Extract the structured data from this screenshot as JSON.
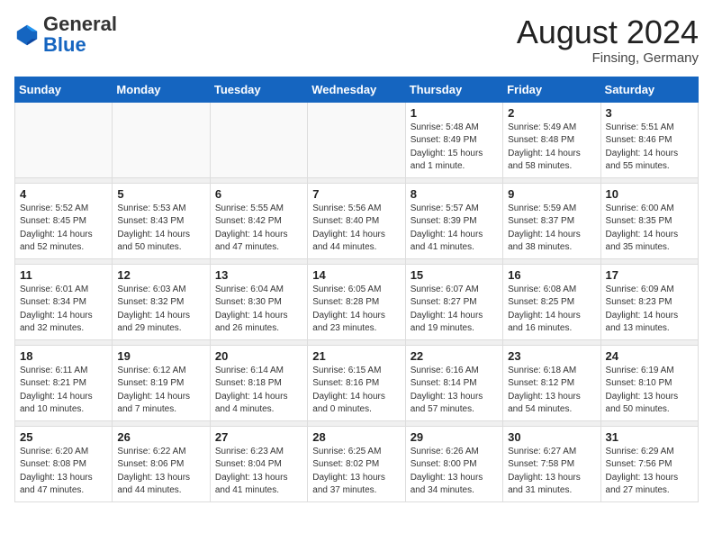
{
  "header": {
    "logo": {
      "general": "General",
      "blue": "Blue"
    },
    "title": "August 2024",
    "location": "Finsing, Germany"
  },
  "calendar": {
    "days_of_week": [
      "Sunday",
      "Monday",
      "Tuesday",
      "Wednesday",
      "Thursday",
      "Friday",
      "Saturday"
    ],
    "weeks": [
      [
        {
          "num": "",
          "detail": ""
        },
        {
          "num": "",
          "detail": ""
        },
        {
          "num": "",
          "detail": ""
        },
        {
          "num": "",
          "detail": ""
        },
        {
          "num": "1",
          "detail": "Sunrise: 5:48 AM\nSunset: 8:49 PM\nDaylight: 15 hours\nand 1 minute."
        },
        {
          "num": "2",
          "detail": "Sunrise: 5:49 AM\nSunset: 8:48 PM\nDaylight: 14 hours\nand 58 minutes."
        },
        {
          "num": "3",
          "detail": "Sunrise: 5:51 AM\nSunset: 8:46 PM\nDaylight: 14 hours\nand 55 minutes."
        }
      ],
      [
        {
          "num": "4",
          "detail": "Sunrise: 5:52 AM\nSunset: 8:45 PM\nDaylight: 14 hours\nand 52 minutes."
        },
        {
          "num": "5",
          "detail": "Sunrise: 5:53 AM\nSunset: 8:43 PM\nDaylight: 14 hours\nand 50 minutes."
        },
        {
          "num": "6",
          "detail": "Sunrise: 5:55 AM\nSunset: 8:42 PM\nDaylight: 14 hours\nand 47 minutes."
        },
        {
          "num": "7",
          "detail": "Sunrise: 5:56 AM\nSunset: 8:40 PM\nDaylight: 14 hours\nand 44 minutes."
        },
        {
          "num": "8",
          "detail": "Sunrise: 5:57 AM\nSunset: 8:39 PM\nDaylight: 14 hours\nand 41 minutes."
        },
        {
          "num": "9",
          "detail": "Sunrise: 5:59 AM\nSunset: 8:37 PM\nDaylight: 14 hours\nand 38 minutes."
        },
        {
          "num": "10",
          "detail": "Sunrise: 6:00 AM\nSunset: 8:35 PM\nDaylight: 14 hours\nand 35 minutes."
        }
      ],
      [
        {
          "num": "11",
          "detail": "Sunrise: 6:01 AM\nSunset: 8:34 PM\nDaylight: 14 hours\nand 32 minutes."
        },
        {
          "num": "12",
          "detail": "Sunrise: 6:03 AM\nSunset: 8:32 PM\nDaylight: 14 hours\nand 29 minutes."
        },
        {
          "num": "13",
          "detail": "Sunrise: 6:04 AM\nSunset: 8:30 PM\nDaylight: 14 hours\nand 26 minutes."
        },
        {
          "num": "14",
          "detail": "Sunrise: 6:05 AM\nSunset: 8:28 PM\nDaylight: 14 hours\nand 23 minutes."
        },
        {
          "num": "15",
          "detail": "Sunrise: 6:07 AM\nSunset: 8:27 PM\nDaylight: 14 hours\nand 19 minutes."
        },
        {
          "num": "16",
          "detail": "Sunrise: 6:08 AM\nSunset: 8:25 PM\nDaylight: 14 hours\nand 16 minutes."
        },
        {
          "num": "17",
          "detail": "Sunrise: 6:09 AM\nSunset: 8:23 PM\nDaylight: 14 hours\nand 13 minutes."
        }
      ],
      [
        {
          "num": "18",
          "detail": "Sunrise: 6:11 AM\nSunset: 8:21 PM\nDaylight: 14 hours\nand 10 minutes."
        },
        {
          "num": "19",
          "detail": "Sunrise: 6:12 AM\nSunset: 8:19 PM\nDaylight: 14 hours\nand 7 minutes."
        },
        {
          "num": "20",
          "detail": "Sunrise: 6:14 AM\nSunset: 8:18 PM\nDaylight: 14 hours\nand 4 minutes."
        },
        {
          "num": "21",
          "detail": "Sunrise: 6:15 AM\nSunset: 8:16 PM\nDaylight: 14 hours\nand 0 minutes."
        },
        {
          "num": "22",
          "detail": "Sunrise: 6:16 AM\nSunset: 8:14 PM\nDaylight: 13 hours\nand 57 minutes."
        },
        {
          "num": "23",
          "detail": "Sunrise: 6:18 AM\nSunset: 8:12 PM\nDaylight: 13 hours\nand 54 minutes."
        },
        {
          "num": "24",
          "detail": "Sunrise: 6:19 AM\nSunset: 8:10 PM\nDaylight: 13 hours\nand 50 minutes."
        }
      ],
      [
        {
          "num": "25",
          "detail": "Sunrise: 6:20 AM\nSunset: 8:08 PM\nDaylight: 13 hours\nand 47 minutes."
        },
        {
          "num": "26",
          "detail": "Sunrise: 6:22 AM\nSunset: 8:06 PM\nDaylight: 13 hours\nand 44 minutes."
        },
        {
          "num": "27",
          "detail": "Sunrise: 6:23 AM\nSunset: 8:04 PM\nDaylight: 13 hours\nand 41 minutes."
        },
        {
          "num": "28",
          "detail": "Sunrise: 6:25 AM\nSunset: 8:02 PM\nDaylight: 13 hours\nand 37 minutes."
        },
        {
          "num": "29",
          "detail": "Sunrise: 6:26 AM\nSunset: 8:00 PM\nDaylight: 13 hours\nand 34 minutes."
        },
        {
          "num": "30",
          "detail": "Sunrise: 6:27 AM\nSunset: 7:58 PM\nDaylight: 13 hours\nand 31 minutes."
        },
        {
          "num": "31",
          "detail": "Sunrise: 6:29 AM\nSunset: 7:56 PM\nDaylight: 13 hours\nand 27 minutes."
        }
      ]
    ]
  }
}
